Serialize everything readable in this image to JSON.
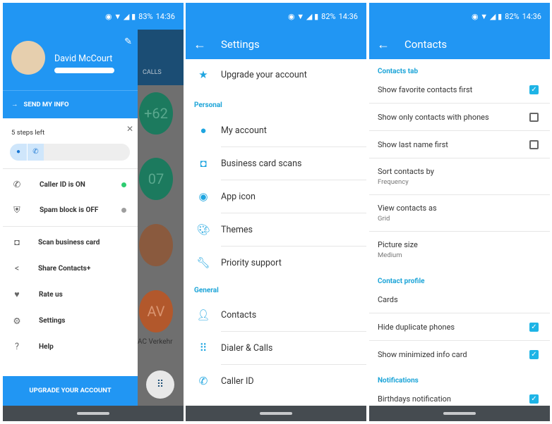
{
  "panel1": {
    "status": {
      "battery": "83%",
      "time": "14:36"
    },
    "profile_name": "David McCourt",
    "send_info": "SEND MY INFO",
    "steps_left": "5 steps left",
    "status_items": [
      {
        "label": "Caller ID is ON",
        "dot": "#2ecc71"
      },
      {
        "label": "Spam block is OFF",
        "dot": "#9e9e9e"
      }
    ],
    "menu": [
      {
        "label": "Scan business card",
        "icon": "camera-icon"
      },
      {
        "label": "Share Contacts+",
        "icon": "share-icon"
      },
      {
        "label": "Rate us",
        "icon": "heart-icon"
      },
      {
        "label": "Settings",
        "icon": "gear-icon"
      },
      {
        "label": "Help",
        "icon": "help-icon"
      }
    ],
    "upgrade": "UPGRADE YOUR ACCOUNT",
    "background": {
      "tab": "CALLS",
      "avatars": [
        "+62",
        "07",
        "AV"
      ],
      "contact_name": "AC Verkehr"
    }
  },
  "panel2": {
    "status": {
      "battery": "82%",
      "time": "14:36"
    },
    "title": "Settings",
    "upgrade": "Upgrade your account",
    "sections": [
      {
        "header": "Personal",
        "items": [
          "My account",
          "Business card scans",
          "App icon",
          "Themes",
          "Priority support"
        ]
      },
      {
        "header": "General",
        "items": [
          "Contacts",
          "Dialer & Calls",
          "Caller ID"
        ]
      }
    ]
  },
  "panel3": {
    "status": {
      "battery": "82%",
      "time": "14:36"
    },
    "title": "Contacts",
    "sections": {
      "contacts_tab": "Contacts tab",
      "contact_profile": "Contact profile",
      "notifications": "Notifications"
    },
    "items": {
      "fav": {
        "label": "Show favorite contacts first",
        "checked": true
      },
      "phones": {
        "label": "Show only contacts with phones",
        "checked": false
      },
      "last": {
        "label": "Show last name first",
        "checked": false
      },
      "sort": {
        "label": "Sort contacts by",
        "value": "Frequency"
      },
      "view": {
        "label": "View contacts as",
        "value": "Grid"
      },
      "pic": {
        "label": "Picture size",
        "value": "Medium"
      },
      "cards": {
        "label": "Cards"
      },
      "dup": {
        "label": "Hide duplicate phones",
        "checked": true
      },
      "mini": {
        "label": "Show minimized info card",
        "checked": true
      },
      "bday": {
        "label": "Birthdays notification",
        "checked": true
      }
    }
  },
  "colors": {
    "primary": "#2196f3",
    "accent": "#1ea5d8"
  }
}
